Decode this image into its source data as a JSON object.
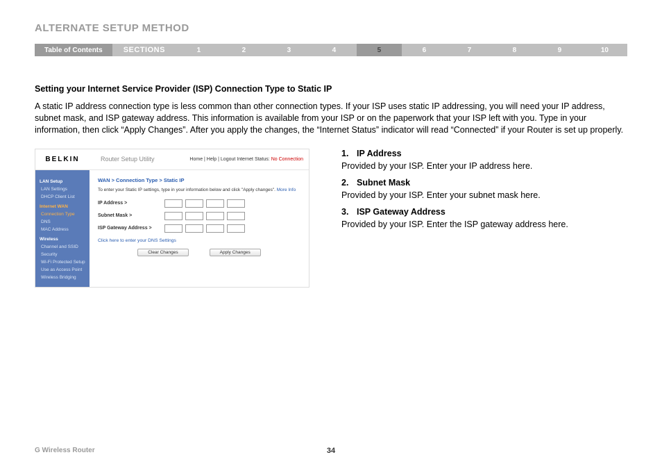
{
  "header": {
    "title": "ALTERNATE SETUP METHOD",
    "toc_label": "Table of Contents",
    "sections_label": "SECTIONS",
    "numbers": [
      "1",
      "2",
      "3",
      "4",
      "5",
      "6",
      "7",
      "8",
      "9",
      "10"
    ],
    "active": "5"
  },
  "section": {
    "heading": "Setting your Internet Service Provider (ISP) Connection Type to Static IP",
    "body": "A static IP address connection type is less common than other connection types. If your ISP uses static IP addressing, you will need your IP address, subnet mask, and ISP gateway address. This information is available from your ISP or on the paperwork that your ISP left with you. Type in your information, then click “Apply Changes”. After you apply the changes, the “Internet Status” indicator will read “Connected” if your Router is set up properly."
  },
  "ui": {
    "logo": "BELKIN",
    "utility": "Router Setup Utility",
    "toplinks_prefix": "Home | Help | Logout   Internet Status: ",
    "toplinks_status": "No Connection",
    "side_lan": "LAN Setup",
    "side_lan1": "LAN Settings",
    "side_lan2": "DHCP Client List",
    "side_wan": "Internet WAN",
    "side_wan1": "Connection Type",
    "side_wan2": "DNS",
    "side_wan3": "MAC Address",
    "side_wl": "Wireless",
    "side_wl1": "Channel and SSID",
    "side_wl2": "Security",
    "side_wl3": "Wi-Fi Protected Setup",
    "side_wl4": "Use as Access Point",
    "side_wl5": "Wireless Bridging",
    "breadcrumb": "WAN > Connection Type > Static IP",
    "instr": "To enter your Static IP settings, type in your information below and click \"Apply changes\". ",
    "moreinfo": "More Info",
    "f1": "IP Address >",
    "f2": "Subnet Mask >",
    "f3": "ISP Gateway Address >",
    "dns_link": "Click here to enter your DNS Settings",
    "btn_clear": "Clear Changes",
    "btn_apply": "Apply Changes"
  },
  "right": {
    "h1_num": "1.",
    "h1": "IP Address",
    "p1": "Provided by your ISP. Enter your IP address here.",
    "h2_num": "2.",
    "h2": "Subnet Mask",
    "p2": "Provided by your ISP. Enter your subnet mask here.",
    "h3_num": "3.",
    "h3": "ISP Gateway Address",
    "p3": "Provided by your ISP. Enter the ISP gateway address here."
  },
  "footer": {
    "product": "G Wireless Router",
    "page": "34"
  }
}
